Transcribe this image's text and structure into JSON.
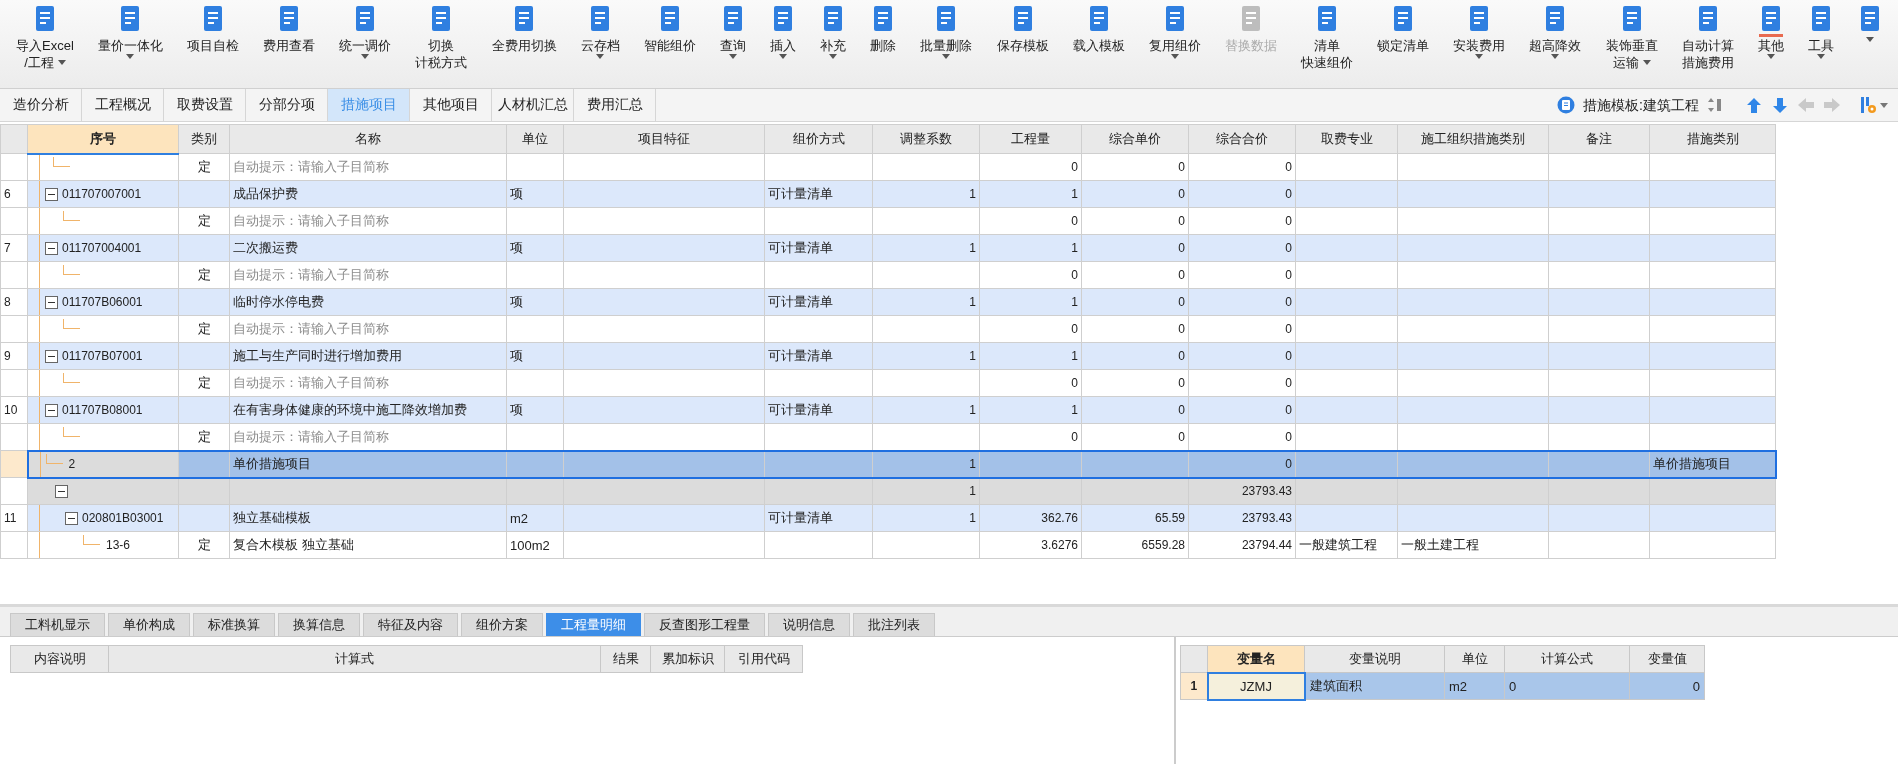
{
  "toolbar": [
    {
      "label": [
        "导入Excel",
        "/工程"
      ],
      "caret": true,
      "disabled": false,
      "selected": false
    },
    {
      "label": [
        "量价一体化"
      ],
      "caret": true,
      "disabled": false,
      "selected": false
    },
    {
      "label": [
        "项目自检"
      ],
      "caret": false,
      "disabled": false,
      "selected": false
    },
    {
      "label": [
        "费用查看"
      ],
      "caret": false,
      "disabled": false,
      "selected": false
    },
    {
      "label": [
        "统一调价"
      ],
      "caret": true,
      "disabled": false,
      "selected": false
    },
    {
      "label": [
        "切换",
        "计税方式"
      ],
      "caret": false,
      "disabled": false,
      "selected": false
    },
    {
      "label": [
        "全费用切换"
      ],
      "caret": false,
      "disabled": false,
      "selected": false
    },
    {
      "label": [
        "云存档"
      ],
      "caret": true,
      "disabled": false,
      "selected": false
    },
    {
      "label": [
        "智能组价"
      ],
      "caret": false,
      "disabled": false,
      "selected": false
    },
    {
      "label": [
        "查询"
      ],
      "caret": true,
      "disabled": false,
      "selected": false
    },
    {
      "label": [
        "插入"
      ],
      "caret": true,
      "disabled": false,
      "selected": false
    },
    {
      "label": [
        "补充"
      ],
      "caret": true,
      "disabled": false,
      "selected": false
    },
    {
      "label": [
        "删除"
      ],
      "caret": false,
      "disabled": false,
      "selected": false
    },
    {
      "label": [
        "批量删除"
      ],
      "caret": true,
      "disabled": false,
      "selected": false
    },
    {
      "label": [
        "保存模板"
      ],
      "caret": false,
      "disabled": false,
      "selected": false
    },
    {
      "label": [
        "载入模板"
      ],
      "caret": false,
      "disabled": false,
      "selected": false
    },
    {
      "label": [
        "复用组价"
      ],
      "caret": true,
      "disabled": false,
      "selected": false
    },
    {
      "label": [
        "替换数据"
      ],
      "caret": false,
      "disabled": true,
      "selected": false
    },
    {
      "label": [
        "清单",
        "快速组价"
      ],
      "caret": false,
      "disabled": false,
      "selected": false
    },
    {
      "label": [
        "锁定清单"
      ],
      "caret": false,
      "disabled": false,
      "selected": false
    },
    {
      "label": [
        "安装费用"
      ],
      "caret": true,
      "disabled": false,
      "selected": false
    },
    {
      "label": [
        "超高降效"
      ],
      "caret": true,
      "disabled": false,
      "selected": false
    },
    {
      "label": [
        "装饰垂直",
        "运输"
      ],
      "caret": true,
      "disabled": false,
      "selected": false
    },
    {
      "label": [
        "自动计算",
        "措施费用"
      ],
      "caret": false,
      "disabled": false,
      "selected": false
    },
    {
      "label": [
        "其他"
      ],
      "caret": true,
      "disabled": false,
      "selected": true
    },
    {
      "label": [
        "工具"
      ],
      "caret": true,
      "disabled": false,
      "selected": false
    },
    {
      "caret": true,
      "disabled": false,
      "selected": false
    }
  ],
  "tabs": [
    {
      "label": "造价分析",
      "selected": false
    },
    {
      "label": "工程概况",
      "selected": false
    },
    {
      "label": "取费设置",
      "selected": false
    },
    {
      "label": "分部分项",
      "selected": false
    },
    {
      "label": "措施项目",
      "selected": true
    },
    {
      "label": "其他项目",
      "selected": false
    },
    {
      "label": "人材机汇总",
      "selected": false
    },
    {
      "label": "费用汇总",
      "selected": false
    }
  ],
  "template": {
    "label": "措施模板:建筑工程"
  },
  "nav": [
    {
      "kind": "up",
      "disabled": false
    },
    {
      "kind": "down",
      "disabled": false
    },
    {
      "kind": "left",
      "disabled": true
    },
    {
      "kind": "right",
      "disabled": true
    }
  ],
  "table": {
    "columns": [
      {
        "label": "序号",
        "selected": true
      },
      {
        "label": "类别",
        "selected": false
      },
      {
        "label": "名称",
        "selected": false
      },
      {
        "label": "单位",
        "selected": false
      },
      {
        "label": "项目特征",
        "selected": false
      },
      {
        "label": "组价方式",
        "selected": false
      },
      {
        "label": "调整系数",
        "selected": false
      },
      {
        "label": "工程量",
        "selected": false
      },
      {
        "label": "综合单价",
        "selected": false
      },
      {
        "label": "综合合价",
        "selected": false
      },
      {
        "label": "取费专业",
        "selected": false
      },
      {
        "label": "施工组织措施类别",
        "selected": false
      },
      {
        "label": "备注",
        "selected": false
      },
      {
        "label": "措施类别",
        "selected": false
      }
    ],
    "rows": [
      {
        "kind": "sub",
        "selected": false,
        "cells": {
          "type": "定",
          "name": "自动提示：请输入子目简称",
          "qty": "0",
          "unit_price": "0",
          "total": "0"
        }
      },
      {
        "kind": "item",
        "number": "6",
        "expanded": true,
        "selected": false,
        "cells": {
          "code": "011707007001",
          "name": "成品保护费",
          "unit": "项",
          "method": "可计量清单",
          "coef": "1",
          "qty": "1",
          "unit_price": "0",
          "total": "0"
        },
        "children": [
          {
            "kind": "sub",
            "selected": false,
            "cells": {
              "type": "定",
              "name": "自动提示：请输入子目简称",
              "qty": "0",
              "unit_price": "0",
              "total": "0"
            }
          }
        ]
      },
      {
        "kind": "item",
        "number": "7",
        "expanded": true,
        "selected": false,
        "cells": {
          "code": "011707004001",
          "name": "二次搬运费",
          "unit": "项",
          "method": "可计量清单",
          "coef": "1",
          "qty": "1",
          "unit_price": "0",
          "total": "0"
        },
        "children": [
          {
            "kind": "sub",
            "selected": false,
            "cells": {
              "type": "定",
              "name": "自动提示：请输入子目简称",
              "qty": "0",
              "unit_price": "0",
              "total": "0"
            }
          }
        ]
      },
      {
        "kind": "item",
        "number": "8",
        "expanded": true,
        "selected": false,
        "cells": {
          "code": "011707B06001",
          "name": "临时停水停电费",
          "unit": "项",
          "method": "可计量清单",
          "coef": "1",
          "qty": "1",
          "unit_price": "0",
          "total": "0"
        },
        "children": [
          {
            "kind": "sub",
            "selected": false,
            "cells": {
              "type": "定",
              "name": "自动提示：请输入子目简称",
              "qty": "0",
              "unit_price": "0",
              "total": "0"
            }
          }
        ]
      },
      {
        "kind": "item",
        "number": "9",
        "expanded": true,
        "selected": false,
        "cells": {
          "code": "011707B07001",
          "name": "施工与生产同时进行增加费用",
          "unit": "项",
          "method": "可计量清单",
          "coef": "1",
          "qty": "1",
          "unit_price": "0",
          "total": "0"
        },
        "children": [
          {
            "kind": "sub",
            "selected": false,
            "cells": {
              "type": "定",
              "name": "自动提示：请输入子目简称",
              "qty": "0",
              "unit_price": "0",
              "total": "0"
            }
          }
        ]
      },
      {
        "kind": "item",
        "number": "10",
        "expanded": true,
        "selected": false,
        "cells": {
          "code": "011707B08001",
          "name": "在有害身体健康的环境中施工降效增加费",
          "unit": "项",
          "method": "可计量清单",
          "coef": "1",
          "qty": "1",
          "unit_price": "0",
          "total": "0"
        },
        "children": [
          {
            "kind": "sub",
            "selected": false,
            "cells": {
              "type": "定",
              "name": "自动提示：请输入子目简称",
              "qty": "0",
              "unit_price": "0",
              "total": "0"
            }
          }
        ]
      },
      {
        "kind": "group",
        "selected": true,
        "cells": {
          "code": "2",
          "name": "单价措施项目",
          "coef": "1",
          "total": "0",
          "measure_category": "单价措施项目"
        },
        "children": [
          {
            "kind": "summary",
            "expanded": true,
            "selected": false,
            "cells": {
              "coef": "1",
              "total": "23793.43"
            },
            "children": [
              {
                "kind": "item",
                "number": "11",
                "expanded": true,
                "selected": false,
                "cells": {
                  "code": "020801B03001",
                  "name": "独立基础模板",
                  "unit": "m2",
                  "method": "可计量清单",
                  "coef": "1",
                  "qty": "362.76",
                  "unit_price": "65.59",
                  "total": "23793.43"
                },
                "children": [
                  {
                    "kind": "sub",
                    "selected": false,
                    "cells": {
                      "code": "13-6",
                      "type": "定",
                      "name": "复合木模板 独立基础",
                      "unit": "100m2",
                      "qty": "3.6276",
                      "unit_price": "6559.28",
                      "total": "23794.44",
                      "fee_major": "一般建筑工程",
                      "org_category": "一般土建工程"
                    }
                  }
                ]
              }
            ]
          }
        ]
      }
    ]
  },
  "bottom_tabs": [
    {
      "label": "工料机显示",
      "selected": false
    },
    {
      "label": "单价构成",
      "selected": false
    },
    {
      "label": "标准换算",
      "selected": false
    },
    {
      "label": "换算信息",
      "selected": false
    },
    {
      "label": "特征及内容",
      "selected": false
    },
    {
      "label": "组价方案",
      "selected": false
    },
    {
      "label": "工程量明细",
      "selected": true
    },
    {
      "label": "反查图形工程量",
      "selected": false
    },
    {
      "label": "说明信息",
      "selected": false
    },
    {
      "label": "批注列表",
      "selected": false
    }
  ],
  "detail_table": {
    "columns": [
      "内容说明",
      "计算式",
      "结果",
      "累加标识",
      "引用代码"
    ]
  },
  "variables": {
    "columns": [
      {
        "label": "变量名",
        "selected": true
      },
      {
        "label": "变量说明",
        "selected": false
      },
      {
        "label": "单位",
        "selected": false
      },
      {
        "label": "计算公式",
        "selected": false
      },
      {
        "label": "变量值",
        "selected": false
      }
    ],
    "rows": [
      {
        "number": "1",
        "selected": true,
        "cells": [
          "JZMJ",
          "建筑面积",
          "m2",
          "0",
          "0"
        ]
      }
    ]
  }
}
